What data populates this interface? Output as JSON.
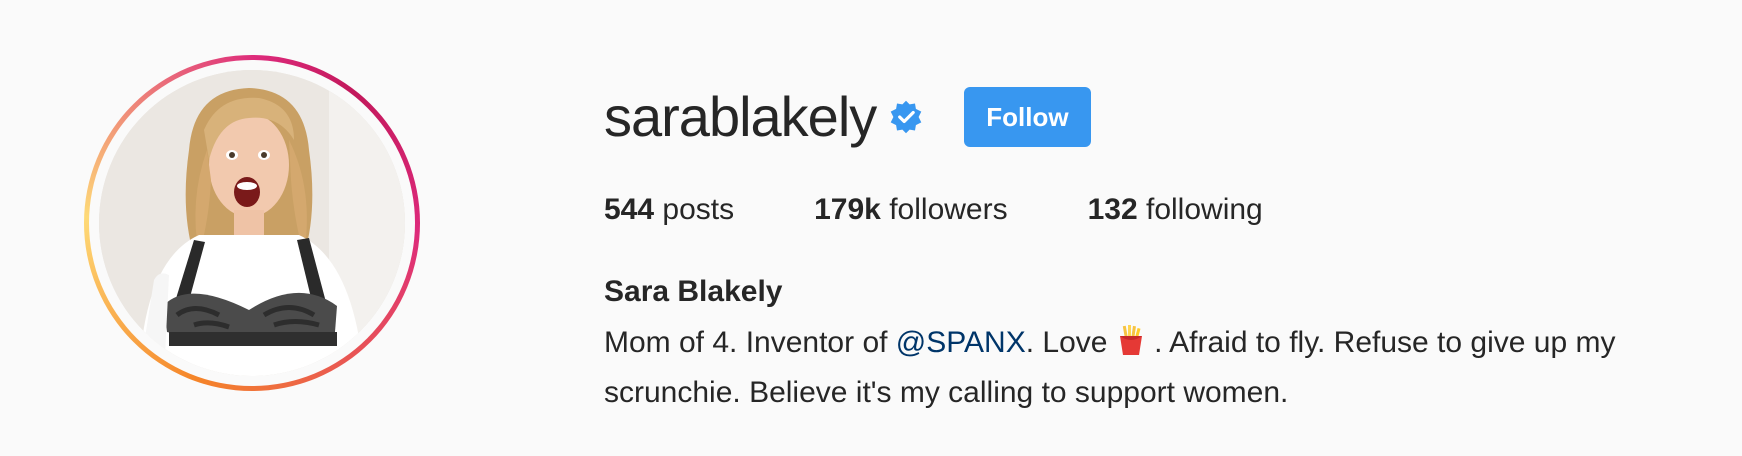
{
  "profile": {
    "username": "sarablakely",
    "verified": true,
    "follow_label": "Follow",
    "accent_color": "#3897f0",
    "stats": {
      "posts_count": "544",
      "posts_label": "posts",
      "followers_count": "179k",
      "followers_label": "followers",
      "following_count": "132",
      "following_label": "following"
    },
    "full_name": "Sara Blakely",
    "bio": {
      "part1": "Mom of 4. Inventor of ",
      "mention": "@SPANX",
      "part2": ". Love ",
      "emoji_icon": "french-fries-icon",
      "part3": " . Afraid to fly. Refuse to give up my scrunchie. Believe it's my calling to support women."
    }
  }
}
